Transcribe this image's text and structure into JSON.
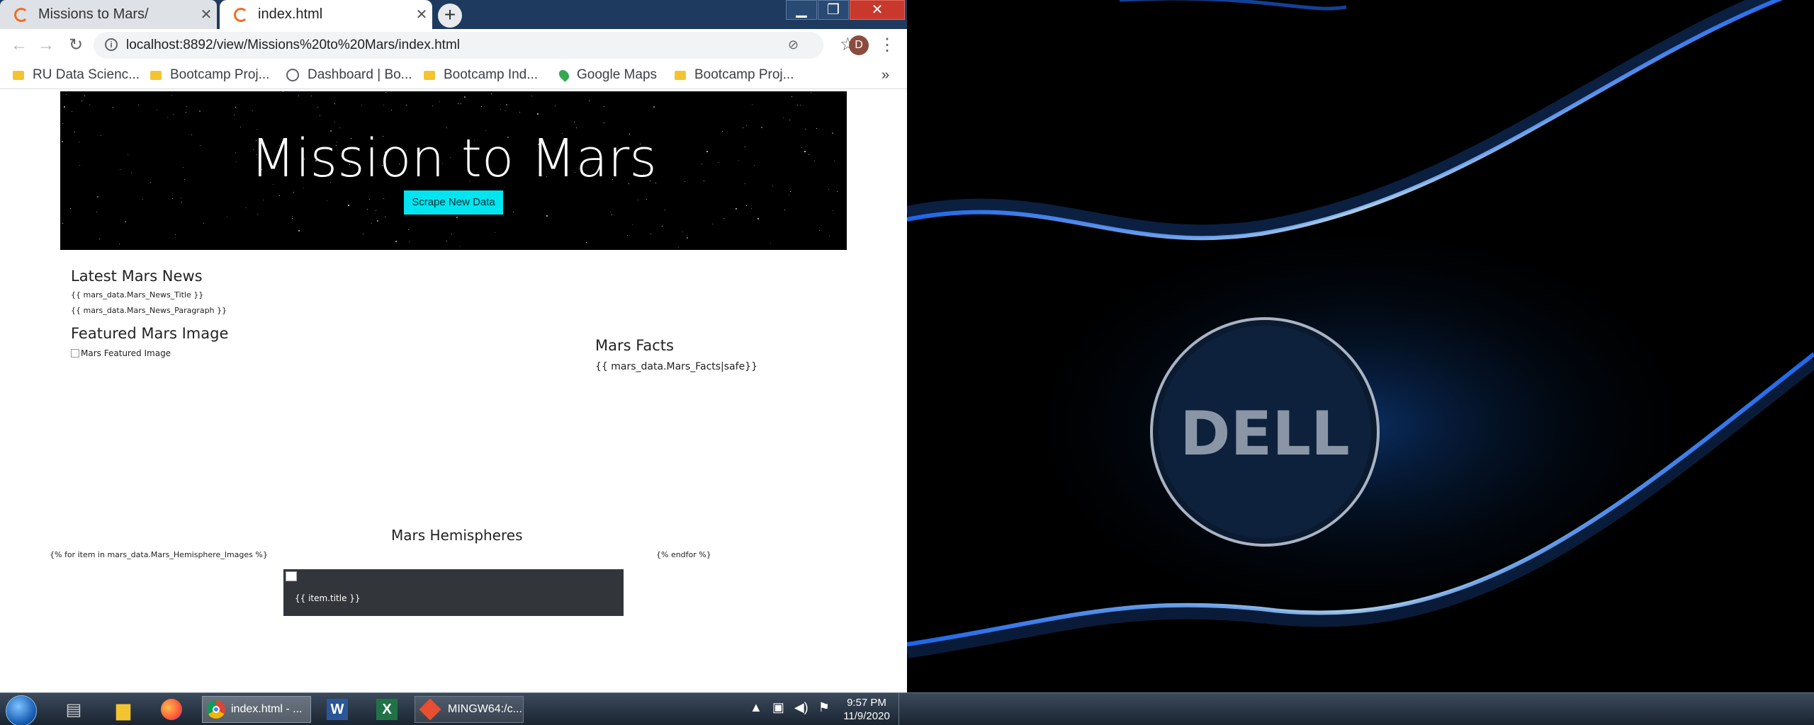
{
  "browser": {
    "tabs": [
      {
        "title": "Missions to Mars/"
      },
      {
        "title": "index.html"
      }
    ],
    "new_tab": "+",
    "window_controls": {
      "minimize": "▁",
      "maximize": "❐",
      "close": "✕"
    },
    "url": "localhost:8892/view/Missions%20to%20Mars/index.html",
    "avatar_letter": "D",
    "bookmarks": [
      {
        "label": "RU Data Scienc...",
        "icon": "folder-icon"
      },
      {
        "label": "Bootcamp Proj...",
        "icon": "folder-icon"
      },
      {
        "label": "Dashboard | Bo...",
        "icon": "globe-icon"
      },
      {
        "label": "Bootcamp Ind...",
        "icon": "folder-icon"
      },
      {
        "label": "Google Maps",
        "icon": "maps-icon"
      },
      {
        "label": "Bootcamp Proj...",
        "icon": "folder-icon"
      }
    ],
    "bookmarks_more": "»"
  },
  "page": {
    "hero_title": "Mission to Mars",
    "scrape_button": "Scrape New Data",
    "news_heading": "Latest Mars News",
    "news_title": "{{ mars_data.Mars_News_Title }}",
    "news_paragraph": "{{ mars_data.Mars_News_Paragraph }}",
    "featured_heading": "Featured Mars Image",
    "featured_alt": "Mars Featured Image",
    "facts_heading": "Mars Facts",
    "facts_value": "{{ mars_data.Mars_Facts|safe}}",
    "hemispheres_heading": "Mars Hemispheres",
    "hemi_for": "{% for item in mars_data.Mars_Hemisphere_Images %}",
    "hemi_endfor": "{% endfor %}",
    "hemi_item_title": "{{ item.title }}"
  },
  "taskbar": {
    "chrome_label": "index.html - ...",
    "mingw_label": "MINGW64:/c...",
    "time": "9:57 PM",
    "date": "11/9/2020"
  },
  "colors": {
    "scrape_button": "#00e5f0",
    "hemi_card": "#32353a"
  }
}
